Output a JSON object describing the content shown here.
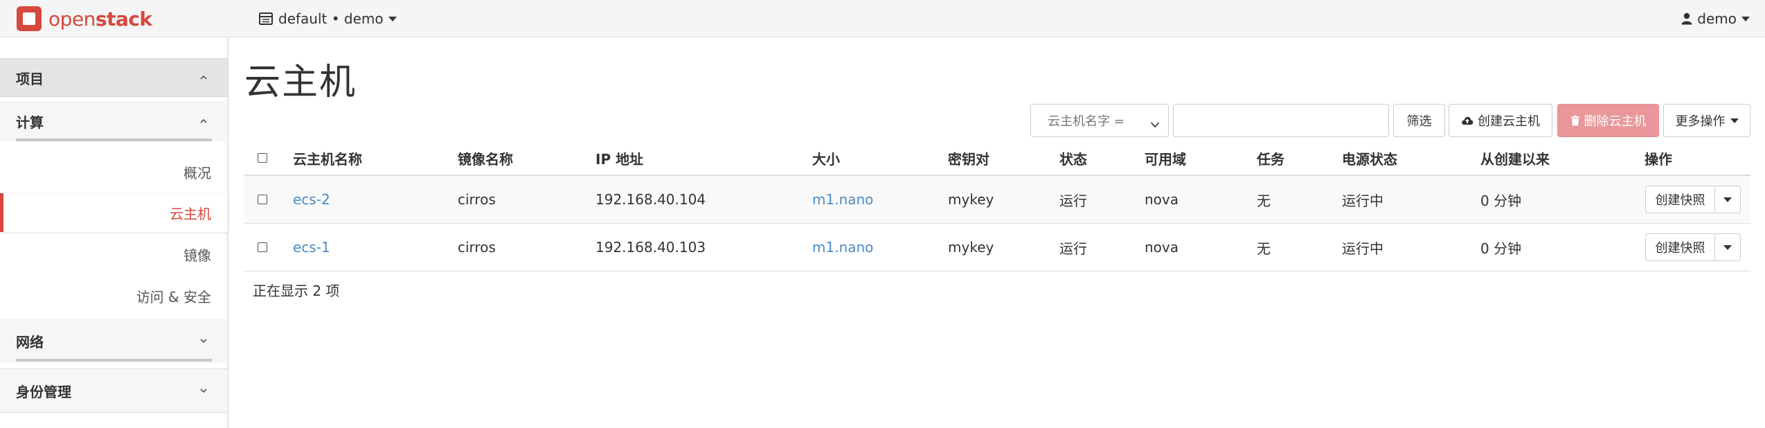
{
  "navbar": {
    "brand_light": "open",
    "brand_bold": "stack",
    "project_switch": "default • demo",
    "user": "demo"
  },
  "sidebar": {
    "project": "项目",
    "compute": {
      "label": "计算",
      "items": [
        "概况",
        "云主机",
        "镜像",
        "访问 & 安全"
      ],
      "active": "云主机"
    },
    "network": "网络",
    "identity": "身份管理"
  },
  "page": {
    "title": "云主机"
  },
  "toolbar": {
    "filter_select": "云主机名字 =",
    "filter_input_value": "",
    "filter_button": "筛选",
    "create_button": "创建云主机",
    "delete_button": "删除云主机",
    "more_button": "更多操作"
  },
  "table": {
    "columns": [
      "云主机名称",
      "镜像名称",
      "IP 地址",
      "大小",
      "密钥对",
      "状态",
      "可用域",
      "任务",
      "电源状态",
      "从创建以来",
      "操作"
    ],
    "rows": [
      {
        "name": "ecs-2",
        "image": "cirros",
        "ip": "192.168.40.104",
        "size": "m1.nano",
        "keypair": "mykey",
        "status": "运行",
        "zone": "nova",
        "task": "无",
        "power": "运行中",
        "age": "0 分钟",
        "action": "创建快照"
      },
      {
        "name": "ecs-1",
        "image": "cirros",
        "ip": "192.168.40.103",
        "size": "m1.nano",
        "keypair": "mykey",
        "status": "运行",
        "zone": "nova",
        "task": "无",
        "power": "运行中",
        "age": "0 分钟",
        "action": "创建快照"
      }
    ],
    "footer": "正在显示 2 项"
  },
  "colors": {
    "accent": "#d6483e",
    "link": "#4a8bc7",
    "danger_button": "#e9979a"
  },
  "icons": [
    "openstack-logo-icon",
    "project-icon",
    "user-icon",
    "cloud-upload-icon",
    "trash-icon",
    "chevron-up-icon",
    "chevron-down-icon",
    "caret-down-icon"
  ]
}
